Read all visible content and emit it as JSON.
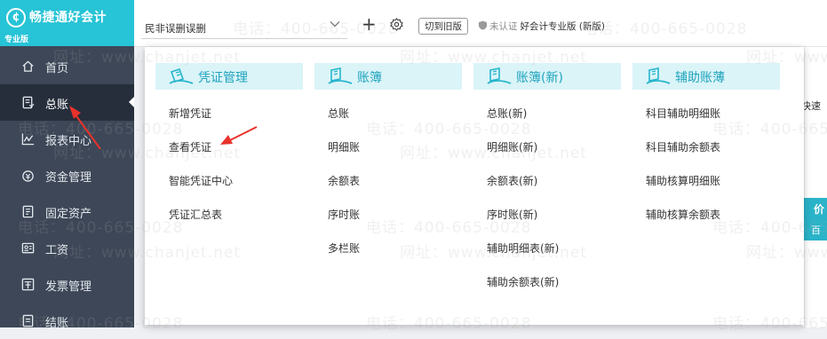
{
  "app": {
    "logo_name": "畅捷通好会计",
    "edition": "专业版"
  },
  "sidebar": {
    "items": [
      {
        "label": "首页",
        "icon": "home-icon"
      },
      {
        "label": "总账",
        "icon": "ledger-icon",
        "active": true
      },
      {
        "label": "报表中心",
        "icon": "chart-icon"
      },
      {
        "label": "资金管理",
        "icon": "money-icon"
      },
      {
        "label": "固定资产",
        "icon": "asset-icon"
      },
      {
        "label": "工资",
        "icon": "salary-icon"
      },
      {
        "label": "发票管理",
        "icon": "invoice-icon"
      },
      {
        "label": "结账",
        "icon": "closing-icon"
      }
    ]
  },
  "topbar": {
    "company": "民非误删误删",
    "switch_label": "切到旧版",
    "cert_status": "未认证",
    "product": "好会计专业版 (新版)"
  },
  "background": {
    "quick": "快速",
    "card_line1": "价",
    "card_line2": "百"
  },
  "menu": {
    "columns": [
      {
        "title": "凭证管理",
        "items": [
          "新增凭证",
          "查看凭证",
          "智能凭证中心",
          "凭证汇总表"
        ]
      },
      {
        "title": "账簿",
        "items": [
          "总账",
          "明细账",
          "余额表",
          "序时账",
          "多栏账"
        ]
      },
      {
        "title": "账簿(新)",
        "items": [
          "总账(新)",
          "明细账(新)",
          "余额表(新)",
          "序时账(新)",
          "辅助明细表(新)",
          "辅助余额表(新)"
        ]
      },
      {
        "title": "辅助账薄",
        "items": [
          "科目辅助明细账",
          "科目辅助余额表",
          "辅助核算明细账",
          "辅助核算余额表"
        ]
      }
    ]
  },
  "watermark": {
    "phone": "电话：400-665-0028",
    "site": "网址：www.chanjet.net"
  },
  "colors": {
    "accent": "#27c3d6",
    "sidebar_bg": "#3d4757",
    "sidebar_active": "#262e3b",
    "menu_head_bg": "#daf4f8",
    "menu_head_text": "#1fa3bd",
    "annotation_red": "#e8322b"
  }
}
